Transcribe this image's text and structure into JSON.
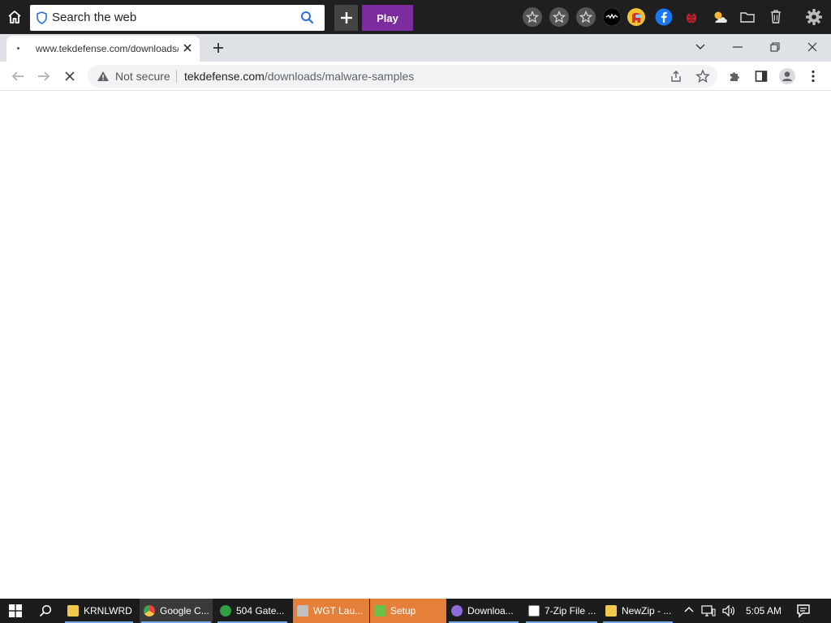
{
  "toolbar": {
    "search_placeholder": "Search the web",
    "play_label": "Play",
    "icons": [
      "home-icon",
      "shield-icon",
      "search-icon",
      "plus-icon",
      "star-icon",
      "star-icon",
      "star-icon",
      "game-icon",
      "among-us-icon",
      "facebook-icon",
      "ladybug-icon",
      "weather-icon",
      "folder-icon",
      "trash-icon",
      "gear-icon"
    ]
  },
  "browser": {
    "tab_title": "www.tekdefense.com/downloads/malware-samples",
    "address": {
      "security_label": "Not secure",
      "host": "tekdefense.com",
      "path": "/downloads/malware-samples"
    }
  },
  "taskbar": {
    "items": [
      {
        "label": "KRNLWRD",
        "icon_color": "#f2c94c"
      },
      {
        "label": "Google C...",
        "icon_color": "#e8453c"
      },
      {
        "label": "504 Gate...",
        "icon_color": "#2ea043"
      },
      {
        "label": "WGT Lau...",
        "icon_color": "#c0c0c0"
      },
      {
        "label": "Setup",
        "icon_color": "#6cc04a"
      },
      {
        "label": "Downloa...",
        "icon_color": "#8e6cd8"
      },
      {
        "label": "7-Zip File ...",
        "icon_color": "#ffffff"
      },
      {
        "label": "NewZip - ...",
        "icon_color": "#f2c94c"
      }
    ],
    "clock": "5:05 AM"
  },
  "colors": {
    "accent_play": "#7b2c9e",
    "task_highlight_orange": "#e5803a"
  }
}
